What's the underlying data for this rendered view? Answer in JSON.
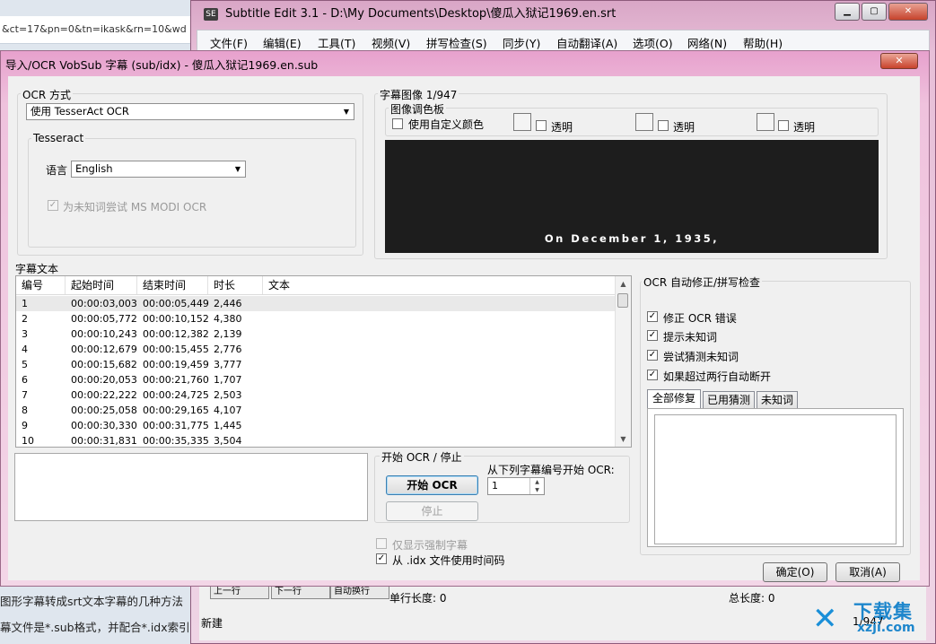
{
  "background": {
    "url_fragment": "&ct=17&pn=0&tn=ikask&rn=10&wd",
    "bottom_text_1": "图形字幕转成srt文本字幕的几种方法",
    "bottom_text_2": "幕文件是*.sub格式，并配合*.idx索引"
  },
  "main_window": {
    "title": "Subtitle Edit 3.1 - D:\\My Documents\\Desktop\\傻瓜入狱记1969.en.srt",
    "menu": [
      "文件(F)",
      "编辑(E)",
      "工具(T)",
      "视频(V)",
      "拼写检查(S)",
      "同步(Y)",
      "自动翻译(A)",
      "选项(O)",
      "网络(N)",
      "帮助(H)"
    ],
    "bottom": {
      "line_length_label": "单行长度: 0",
      "total_length_label": "总长度: 0",
      "status": "新建",
      "position": "1/947",
      "btn_a": "上一行",
      "btn_b": "下一行",
      "btn_c": "自动换行"
    }
  },
  "dialog": {
    "title": "导入/OCR VobSub 字幕 (sub/idx) - 傻瓜入狱记1969.en.sub",
    "ocr_method": {
      "label": "OCR 方式",
      "selected": "使用 TesserAct OCR"
    },
    "tesseract": {
      "label": "Tesseract",
      "language_label": "语言",
      "language_selected": "English",
      "modi_label": "为未知词尝试 MS MODI OCR",
      "modi_checked": "✓"
    },
    "subtitle_image": {
      "label": "字幕图像 1/947",
      "palette_label": "图像调色板",
      "custom_colors_label": "使用自定义颜色",
      "transparent_label": "透明",
      "preview_text": "On December 1, 1935,"
    },
    "subtitle_text": {
      "label": "字幕文本",
      "columns": [
        "编号",
        "起始时间",
        "结束时间",
        "时长",
        "文本"
      ],
      "rows": [
        [
          "1",
          "00:00:03,003",
          "00:00:05,449",
          "2,446",
          ""
        ],
        [
          "2",
          "00:00:05,772",
          "00:00:10,152",
          "4,380",
          ""
        ],
        [
          "3",
          "00:00:10,243",
          "00:00:12,382",
          "2,139",
          ""
        ],
        [
          "4",
          "00:00:12,679",
          "00:00:15,455",
          "2,776",
          ""
        ],
        [
          "5",
          "00:00:15,682",
          "00:00:19,459",
          "3,777",
          ""
        ],
        [
          "6",
          "00:00:20,053",
          "00:00:21,760",
          "1,707",
          ""
        ],
        [
          "7",
          "00:00:22,222",
          "00:00:24,725",
          "2,503",
          ""
        ],
        [
          "8",
          "00:00:25,058",
          "00:00:29,165",
          "4,107",
          ""
        ],
        [
          "9",
          "00:00:30,330",
          "00:00:31,775",
          "1,445",
          ""
        ],
        [
          "10",
          "00:00:31,831",
          "00:00:35,335",
          "3,504",
          ""
        ]
      ]
    },
    "ocr_control": {
      "label": "开始 OCR / 停止",
      "start_button": "开始 OCR",
      "stop_button": "停止",
      "start_from_label": "从下列字幕编号开始 OCR:",
      "start_from_value": "1"
    },
    "options": {
      "forced_only_label": "仅显示强制字幕",
      "use_idx_time_label": "从 .idx 文件使用时间码",
      "use_idx_time_checked": "✓"
    },
    "auto_correct": {
      "label": "OCR 自动修正/拼写检查",
      "items": [
        {
          "label": "修正 OCR 错误",
          "mark": "✓"
        },
        {
          "label": "提示未知词",
          "mark": "✓"
        },
        {
          "label": "尝试猜测未知词",
          "mark": "✓"
        },
        {
          "label": "如果超过两行自动断开",
          "mark": "✓"
        }
      ],
      "tabs": [
        "全部修复",
        "已用猜测",
        "未知词"
      ]
    },
    "ok_button": "确定(O)",
    "cancel_button": "取消(A)"
  },
  "watermark": {
    "brand": "下载集",
    "domain": "xzji.com"
  }
}
